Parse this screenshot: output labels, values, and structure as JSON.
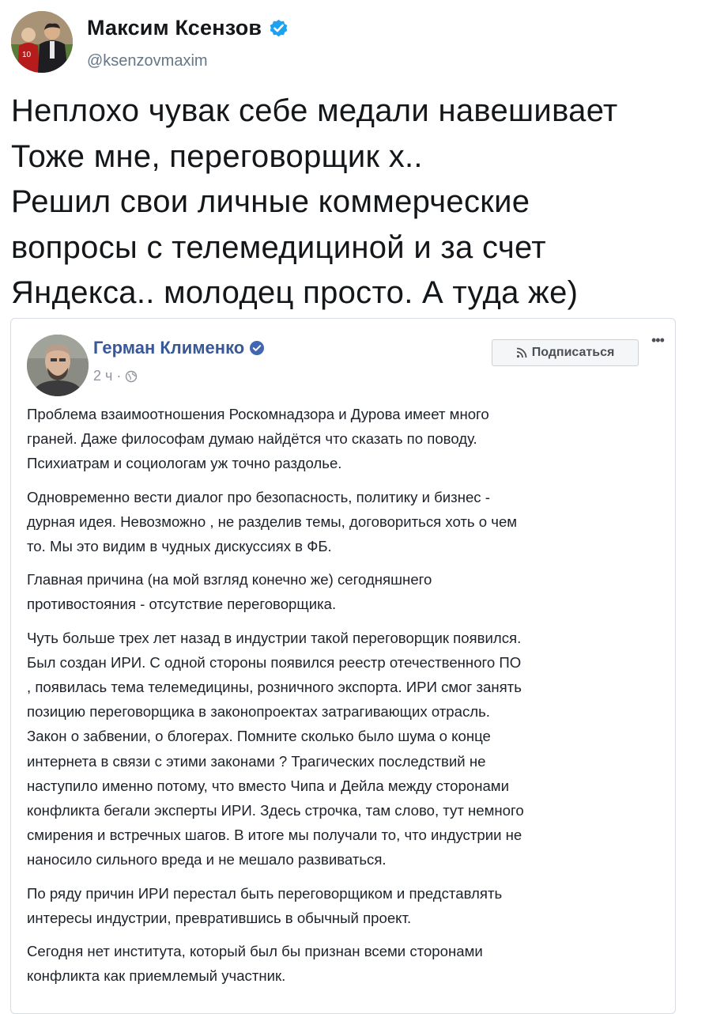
{
  "tweet": {
    "author_name": "Максим Ксензов",
    "author_handle": "@ksenzovmaxim",
    "verified_icon": "verified-badge-icon",
    "text": "Неплохо чувак себе медали навешивает\nТоже мне, переговорщик х..\nРешил свои личные коммерческие\nвопросы  с телемедициной и за счет\nЯндекса.. молодец просто. А туда же)"
  },
  "embedded_post": {
    "author_name": "Герман Клименко",
    "time": "2 ч ·",
    "subscribe_label": "Подписаться",
    "paragraphs": [
      "Проблема взаимоотношения Роскомнадзора и Дурова имеет много\nграней. Даже философам думаю найдётся что сказать по поводу.\nПсихиатрам и социологам уж точно раздолье.",
      "Одновременно вести диалог про безопасность, политику и бизнес -\nдурная идея. Невозможно , не разделив темы, договориться хоть о чем\nто. Мы это видим в чудных дискуссиях в ФБ.",
      "Главная причина (на мой взгляд конечно же) сегодняшнего\nпротивостояния - отсутствие переговорщика.",
      "Чуть больше трех лет назад в индустрии такой переговорщик появился.\nБыл создан ИРИ. С одной стороны появился реестр отечественного ПО\n, появилась тема телемедицины, розничного экспорта. ИРИ смог занять\nпозицию переговорщика в законопроектах затрагивающих отрасль.\nЗакон о забвении, о блогерах. Помните сколько было шума о конце\nинтернета в связи с этими законами ? Трагических последствий не\nнаступило именно потому, что вместо Чипа и Дейла между сторонами\nконфликта бегали эксперты ИРИ. Здесь строчка, там слово, тут немного\nсмирения и встречных шагов. В итоге мы получали то, что индустрии не\nнаносило сильного вреда и не мешало развиваться.",
      "По ряду причин ИРИ перестал быть переговорщиком и представлять\nинтересы индустрии, превратившись в обычный проект.",
      "Сегодня нет института, который был бы признан всеми сторонами\nконфликта как приемлемый участник."
    ]
  },
  "colors": {
    "twitter_text": "#14171a",
    "twitter_secondary": "#657786",
    "twitter_verified": "#1da1f2",
    "facebook_name": "#385898",
    "facebook_text": "#1d2129",
    "facebook_meta": "#90949c"
  }
}
